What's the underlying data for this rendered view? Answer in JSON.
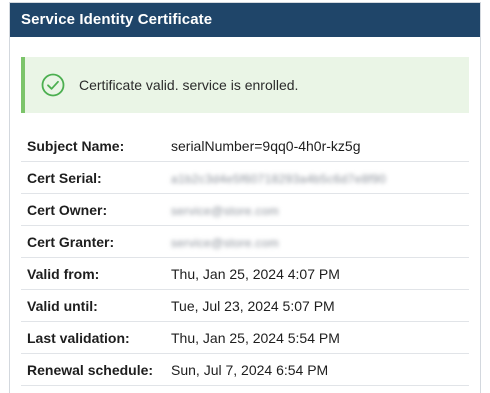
{
  "panel": {
    "title": "Service Identity Certificate"
  },
  "alert": {
    "icon": "check-circle-icon",
    "message": "Certificate valid. service is enrolled.",
    "accent_color": "#7cc46a",
    "background_color": "#eaf5e6"
  },
  "details": {
    "rows": [
      {
        "label": "Subject Name:",
        "value": "serialNumber=9qq0-4h0r-kz5g",
        "redacted": false
      },
      {
        "label": "Cert Serial:",
        "value": "a1b2c3d4e5f60718293a4b5c6d7e8f90",
        "redacted": true
      },
      {
        "label": "Cert Owner:",
        "value": "service@store.com",
        "redacted": true
      },
      {
        "label": "Cert Granter:",
        "value": "service@store.com",
        "redacted": true
      },
      {
        "label": "Valid from:",
        "value": "Thu, Jan 25, 2024 4:07 PM",
        "redacted": false
      },
      {
        "label": "Valid until:",
        "value": "Tue, Jul 23, 2024 5:07 PM",
        "redacted": false
      },
      {
        "label": "Last validation:",
        "value": "Thu, Jan 25, 2024 5:54 PM",
        "redacted": false
      },
      {
        "label": "Renewal schedule:",
        "value": "Sun, Jul 7, 2024 6:54 PM",
        "redacted": false
      }
    ]
  },
  "colors": {
    "header_background": "#1f4569",
    "header_text": "#ffffff"
  }
}
